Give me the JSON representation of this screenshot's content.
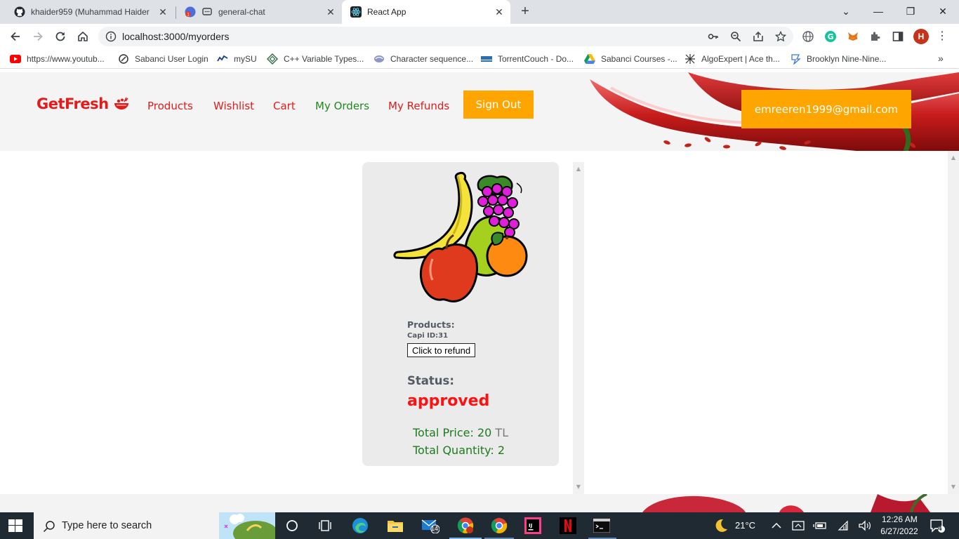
{
  "browser": {
    "tabs": [
      {
        "title": "khaider959 (Muhammad Haider",
        "icon": "github-icon"
      },
      {
        "title": "general-chat",
        "icon": "chat-icon"
      },
      {
        "title": "React App",
        "icon": "react-icon",
        "active": true
      }
    ],
    "url": "localhost:3000/myorders",
    "profile_initial": "H",
    "bookmarks": [
      {
        "label": "https://www.youtub...",
        "icon": "youtube-icon"
      },
      {
        "label": "Sabanci User Login",
        "icon": "sabanci-icon"
      },
      {
        "label": "mySU",
        "icon": "mysu-icon"
      },
      {
        "label": "C++ Variable Types...",
        "icon": "diamond-icon"
      },
      {
        "label": "Character sequence...",
        "icon": "cpp-icon"
      },
      {
        "label": "TorrentCouch - Do...",
        "icon": "couch-icon"
      },
      {
        "label": "Sabanci Courses -...",
        "icon": "drive-icon"
      },
      {
        "label": "AlgoExpert | Ace th...",
        "icon": "algoexpert-icon"
      },
      {
        "label": "Brooklyn Nine-Nine...",
        "icon": "nine-icon"
      }
    ]
  },
  "header": {
    "logo": "GetFresh",
    "nav": [
      {
        "label": "Products"
      },
      {
        "label": "Wishlist"
      },
      {
        "label": "Cart"
      },
      {
        "label": "My Orders",
        "current": true
      },
      {
        "label": "My Refunds"
      }
    ],
    "signout_label": "Sign Out",
    "user_email": "emreeren1999@gmail.com"
  },
  "order": {
    "products_label": "Products:",
    "product_line": "Capi ID:31",
    "refund_label": "Click to refund",
    "status_label": "Status:",
    "status_value": "approved",
    "total_price_label": "Total Price:",
    "total_price_value": "20",
    "total_price_unit": "TL",
    "total_quantity_label": "Total Quantity:",
    "total_quantity_value": "2"
  },
  "taskbar": {
    "search_placeholder": "Type here to search",
    "mail_badge": "14",
    "weather": "21°C",
    "time": "12:26 AM",
    "date": "6/27/2022",
    "notifications": "4"
  },
  "colors": {
    "brand_red": "#e31b1b",
    "accent_orange": "#ffa500",
    "current_green": "#1e8a1e",
    "status_red": "#ff1111"
  }
}
